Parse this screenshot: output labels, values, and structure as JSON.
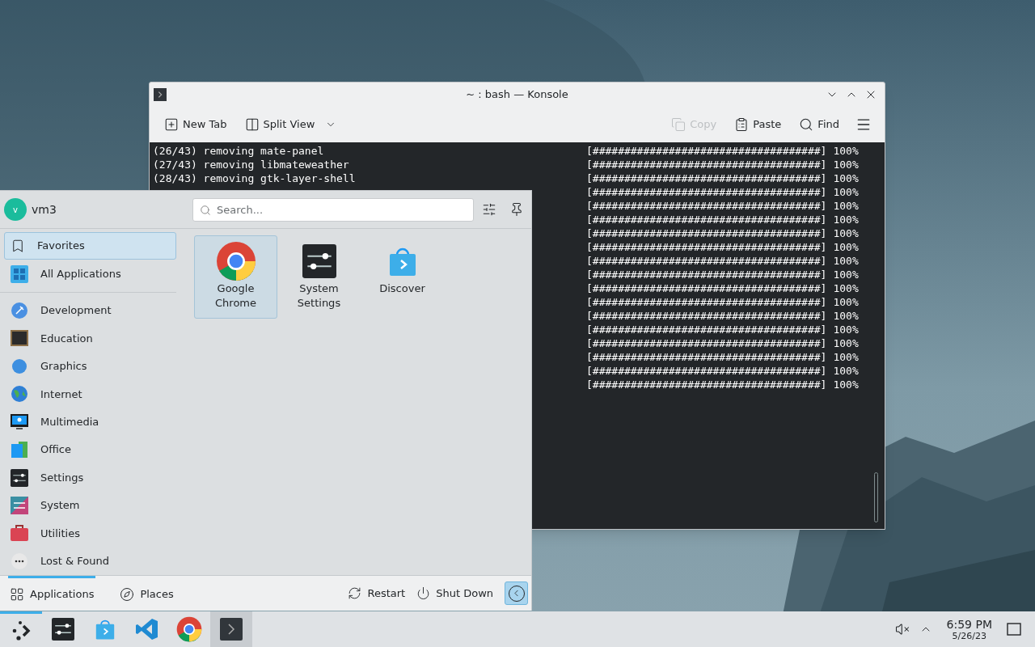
{
  "konsole": {
    "title": "~ : bash — Konsole",
    "toolbar": [
      {
        "kind": "new-tab",
        "label": "New Tab",
        "disabled": false
      },
      {
        "kind": "split-view",
        "label": "Split View",
        "disabled": false
      },
      {
        "kind": "copy",
        "label": "Copy",
        "disabled": true
      },
      {
        "kind": "paste",
        "label": "Paste",
        "disabled": false
      },
      {
        "kind": "find",
        "label": "Find",
        "disabled": false
      }
    ],
    "rows": [
      {
        "text": "(26/43) removing mate-panel",
        "bar": "[####################################]",
        "percent": "100%"
      },
      {
        "text": "(27/43) removing libmateweather",
        "bar": "[####################################]",
        "percent": "100%"
      },
      {
        "text": "(28/43) removing gtk-layer-shell",
        "bar": "[####################################]",
        "percent": "100%"
      },
      {
        "bar": "[####################################]",
        "percent": "100%"
      },
      {
        "bar": "[####################################]",
        "percent": "100%"
      },
      {
        "bar": "[####################################]",
        "percent": "100%"
      },
      {
        "bar": "[####################################]",
        "percent": "100%"
      },
      {
        "bar": "[####################################]",
        "percent": "100%"
      },
      {
        "bar": "[####################################]",
        "percent": "100%"
      },
      {
        "bar": "[####################################]",
        "percent": "100%"
      },
      {
        "bar": "[####################################]",
        "percent": "100%"
      },
      {
        "bar": "[####################################]",
        "percent": "100%"
      },
      {
        "bar": "[####################################]",
        "percent": "100%"
      },
      {
        "bar": "[####################################]",
        "percent": "100%"
      },
      {
        "bar": "[####################################]",
        "percent": "100%"
      },
      {
        "bar": "[####################################]",
        "percent": "100%"
      },
      {
        "bar": "[####################################]",
        "percent": "100%"
      },
      {
        "bar": "[####################################]",
        "percent": "100%"
      }
    ]
  },
  "menu": {
    "user": "vm3",
    "avatar": "v",
    "search": {
      "placeholder": "Search..."
    },
    "sidebar": [
      {
        "kind": "favorites",
        "label": "Favorites",
        "selected": true
      },
      {
        "kind": "all",
        "label": "All Applications",
        "selected": false
      },
      {
        "kind": "development",
        "label": "Development",
        "selected": false
      },
      {
        "kind": "education",
        "label": "Education",
        "selected": false
      },
      {
        "kind": "graphics",
        "label": "Graphics",
        "selected": false
      },
      {
        "kind": "internet",
        "label": "Internet",
        "selected": false
      },
      {
        "kind": "multimedia",
        "label": "Multimedia",
        "selected": false
      },
      {
        "kind": "office",
        "label": "Office",
        "selected": false
      },
      {
        "kind": "settings",
        "label": "Settings",
        "selected": false
      },
      {
        "kind": "system",
        "label": "System",
        "selected": false
      },
      {
        "kind": "utilities",
        "label": "Utilities",
        "selected": false
      },
      {
        "kind": "lost",
        "label": "Lost & Found",
        "selected": false
      }
    ],
    "favorites": [
      {
        "kind": "chrome",
        "label": "Google Chrome",
        "selected": true
      },
      {
        "kind": "settings",
        "label": "System Settings",
        "selected": false
      },
      {
        "kind": "discover",
        "label": "Discover",
        "selected": false
      }
    ],
    "tabs": [
      {
        "kind": "applications",
        "label": "Applications",
        "selected": true
      },
      {
        "kind": "places",
        "label": "Places",
        "selected": false
      }
    ],
    "actions": [
      {
        "kind": "restart",
        "label": "Restart"
      },
      {
        "kind": "shutdown",
        "label": "Shut Down"
      }
    ]
  },
  "taskbar": {
    "items": [
      {
        "kind": "launcher",
        "active": true
      },
      {
        "kind": "settings",
        "active": false
      },
      {
        "kind": "discover",
        "active": false
      },
      {
        "kind": "vscode",
        "active": false
      },
      {
        "kind": "chrome",
        "active": false
      },
      {
        "kind": "konsole",
        "active": true
      }
    ],
    "time": "6:59 PM",
    "date": "5/26/23"
  }
}
